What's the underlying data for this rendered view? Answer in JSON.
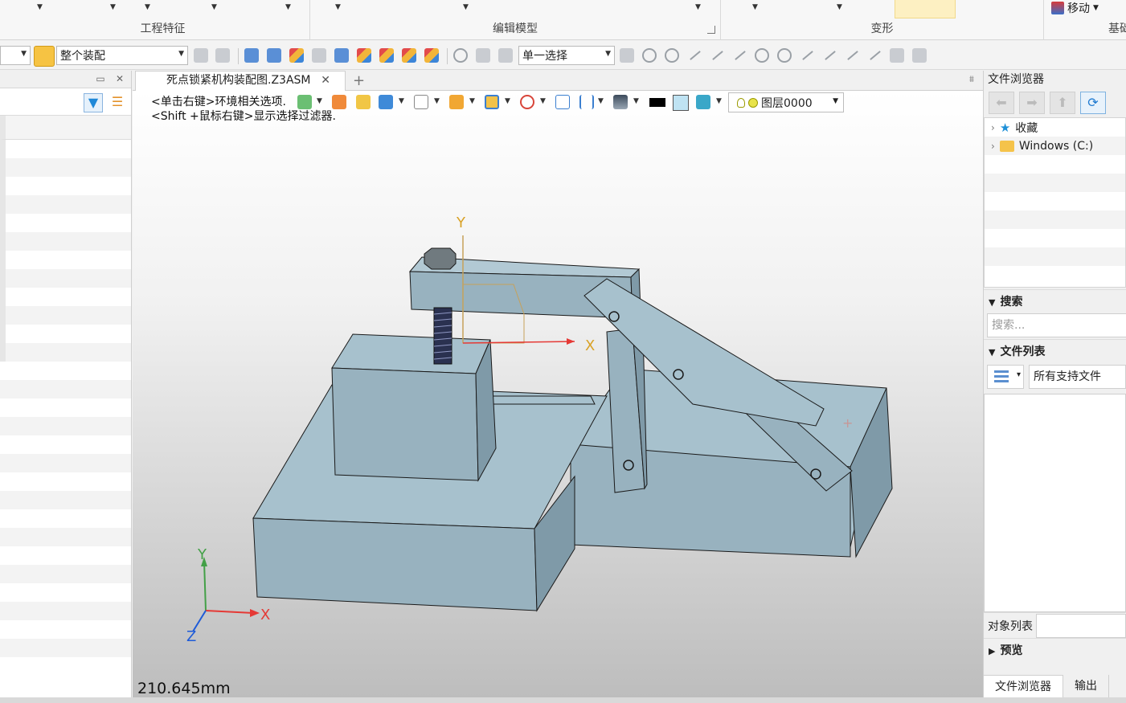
{
  "ribbon": {
    "groups": [
      {
        "label": "工程特征"
      },
      {
        "label": "编辑模型"
      },
      {
        "label": "变形"
      },
      {
        "label": "基础编"
      }
    ],
    "move_label": "移动"
  },
  "toolbar": {
    "assembly_combo": "整个装配",
    "select_combo": "单一选择"
  },
  "document": {
    "tab_title": "死点锁紧机构装配图.Z3ASM",
    "new_tab": "+",
    "close": "✕"
  },
  "viewport": {
    "hint_line1": "<单击右键>环境相关选项.",
    "hint_line2": "<Shift +鼠标右键>显示选择过滤器.",
    "layer": "图层0000",
    "measure": "210.645mm",
    "axis_labels": {
      "x": "X",
      "y": "Y",
      "z": "Z"
    }
  },
  "right_panel": {
    "title": "文件浏览器",
    "tree": [
      {
        "label": "收藏",
        "icon": "star-icon"
      },
      {
        "label": "Windows (C:)",
        "icon": "folder-icon"
      }
    ],
    "search_section": "搜索",
    "search_placeholder": "搜索...",
    "filelist_section": "文件列表",
    "file_type": "所有支持文件",
    "object_list_label": "对象列表",
    "preview_section": "预览",
    "bottom_tabs": [
      "文件浏览器",
      "输出"
    ]
  },
  "colors": {
    "part_top": "#a7c1cd",
    "part_front": "#98b2bf",
    "part_side": "#7f9aa8",
    "axis_x": "#e53935",
    "axis_y": "#43a047",
    "axis_z": "#1e5bd8"
  }
}
